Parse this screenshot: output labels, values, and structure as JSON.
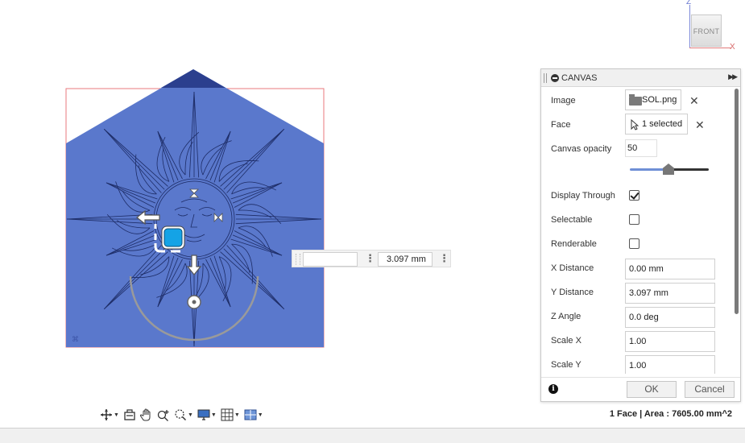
{
  "viewcube": {
    "face_label": "FRONT",
    "axis_z": "Z",
    "axis_x": "X"
  },
  "dimension_input": {
    "value": "3.097 mm"
  },
  "palette": {
    "title": "CANVAS",
    "rows": {
      "image": {
        "label": "Image",
        "file": "SOL.png"
      },
      "face": {
        "label": "Face",
        "selection": "1 selected"
      },
      "opacity": {
        "label": "Canvas opacity",
        "value": "50",
        "slider_fraction": 0.5
      },
      "display_through": {
        "label": "Display Through",
        "checked": true
      },
      "selectable": {
        "label": "Selectable",
        "checked": false
      },
      "renderable": {
        "label": "Renderable",
        "checked": false
      },
      "x_distance": {
        "label": "X Distance",
        "value": "0.00 mm"
      },
      "y_distance": {
        "label": "Y Distance",
        "value": "3.097 mm"
      },
      "z_angle": {
        "label": "Z Angle",
        "value": "0.0 deg"
      },
      "scale_x": {
        "label": "Scale X",
        "value": "1.00"
      },
      "scale_y": {
        "label": "Scale Y",
        "value": "1.00"
      }
    },
    "ok_label": "OK",
    "cancel_label": "Cancel"
  },
  "status": {
    "selection_info": "1 Face | Area : 7605.00 mm^2"
  },
  "colors": {
    "canvas_fill": "#5a78cc",
    "canvas_line": "#1d2c66",
    "gizmo_blue": "#14a3e6",
    "selection_outline": "#e8797e"
  },
  "icons": {
    "toolbar": [
      "orbit-icon",
      "look-at-icon",
      "pan-icon",
      "zoom-icon",
      "fit-icon",
      "display-settings-icon",
      "grid-icon",
      "viewports-icon"
    ]
  }
}
